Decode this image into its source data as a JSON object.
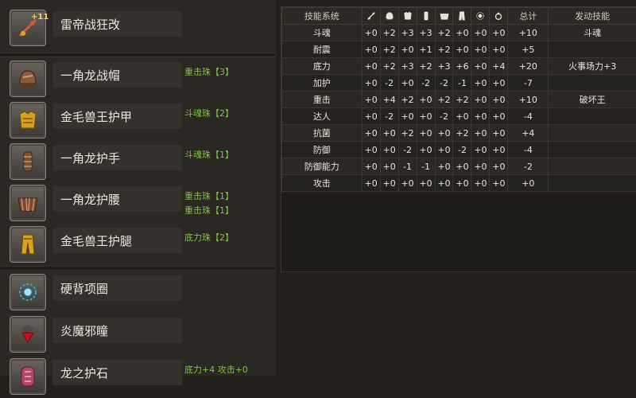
{
  "equipment": [
    {
      "name": "雷帝战狂改",
      "icon": "weapon-icon",
      "badge": "+11",
      "jewels": []
    },
    {
      "name": "一角龙战帽",
      "icon": "helmet-icon",
      "jewels": [
        "重击珠【3】"
      ]
    },
    {
      "name": "金毛兽王护甲",
      "icon": "chest-armor-icon",
      "jewels": [
        "斗魂珠【2】"
      ]
    },
    {
      "name": "一角龙护手",
      "icon": "gauntlet-icon",
      "jewels": [
        "斗魂珠【1】"
      ]
    },
    {
      "name": "一角龙护腰",
      "icon": "waist-armor-icon",
      "jewels": [
        "重击珠【1】",
        "重击珠【1】"
      ]
    },
    {
      "name": "金毛兽王护腿",
      "icon": "leg-armor-icon",
      "jewels": [
        "底力珠【2】"
      ]
    },
    {
      "name": "硬背项圈",
      "icon": "necklace-icon",
      "jewels": []
    },
    {
      "name": "炎魔邪瞳",
      "icon": "ring-gem-icon",
      "jewels": []
    },
    {
      "name": "龙之护石",
      "icon": "talisman-icon",
      "jewels": [
        "底力+4 攻击+0"
      ]
    }
  ],
  "skill_table": {
    "headers": {
      "system": "技能系统",
      "total": "总计",
      "activated": "发动技能"
    },
    "slot_icons": [
      "weapon-icon",
      "helmet-icon",
      "chest-armor-icon",
      "gauntlet-icon",
      "waist-armor-icon",
      "leg-armor-icon",
      "necklace-icon",
      "ring-icon"
    ],
    "rows": [
      {
        "skill": "斗魂",
        "values": [
          "+0",
          "+2",
          "+3",
          "+3",
          "+2",
          "+0",
          "+0",
          "+0"
        ],
        "total": "+10",
        "activated": "斗魂"
      },
      {
        "skill": "耐震",
        "values": [
          "+0",
          "+2",
          "+0",
          "+1",
          "+2",
          "+0",
          "+0",
          "+0"
        ],
        "total": "+5",
        "activated": ""
      },
      {
        "skill": "底力",
        "values": [
          "+0",
          "+2",
          "+3",
          "+2",
          "+3",
          "+6",
          "+0",
          "+4"
        ],
        "total": "+20",
        "activated": "火事场力+3"
      },
      {
        "skill": "加护",
        "values": [
          "+0",
          "-2",
          "+0",
          "-2",
          "-2",
          "-1",
          "+0",
          "+0"
        ],
        "total": "-7",
        "activated": ""
      },
      {
        "skill": "重击",
        "values": [
          "+0",
          "+4",
          "+2",
          "+0",
          "+2",
          "+2",
          "+0",
          "+0"
        ],
        "total": "+10",
        "activated": "破坏王"
      },
      {
        "skill": "达人",
        "values": [
          "+0",
          "-2",
          "+0",
          "+0",
          "-2",
          "+0",
          "+0",
          "+0"
        ],
        "total": "-4",
        "activated": ""
      },
      {
        "skill": "抗菌",
        "values": [
          "+0",
          "+0",
          "+2",
          "+0",
          "+0",
          "+2",
          "+0",
          "+0"
        ],
        "total": "+4",
        "activated": ""
      },
      {
        "skill": "防御",
        "values": [
          "+0",
          "+0",
          "-2",
          "+0",
          "+0",
          "-2",
          "+0",
          "+0"
        ],
        "total": "-4",
        "activated": ""
      },
      {
        "skill": "防御能力",
        "values": [
          "+0",
          "+0",
          "-1",
          "-1",
          "+0",
          "+0",
          "+0",
          "+0"
        ],
        "total": "-2",
        "activated": ""
      },
      {
        "skill": "攻击",
        "values": [
          "+0",
          "+0",
          "+0",
          "+0",
          "+0",
          "+0",
          "+0",
          "+0"
        ],
        "total": "+0",
        "activated": ""
      }
    ]
  }
}
